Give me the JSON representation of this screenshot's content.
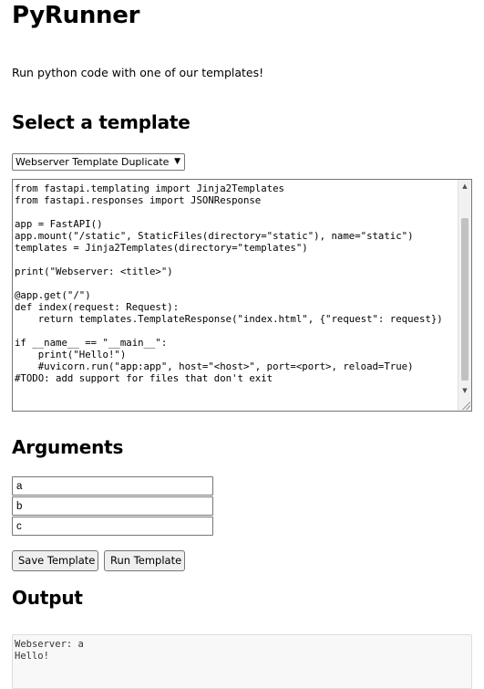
{
  "header": {
    "title": "PyRunner",
    "intro": "Run python code with one of our templates!"
  },
  "template_section": {
    "heading": "Select a template",
    "selected": "Webserver Template Duplicate",
    "code": "from fastapi.templating import Jinja2Templates\nfrom fastapi.responses import JSONResponse\n\napp = FastAPI()\napp.mount(\"/static\", StaticFiles(directory=\"static\"), name=\"static\")\ntemplates = Jinja2Templates(directory=\"templates\")\n\nprint(\"Webserver: <title>\")\n\n@app.get(\"/\")\ndef index(request: Request):\n    return templates.TemplateResponse(\"index.html\", {\"request\": request})\n\nif __name__ == \"__main__\":\n    print(\"Hello!\")\n    #uvicorn.run(\"app:app\", host=\"<host>\", port=<port>, reload=True)\n#TODO: add support for files that don't exit"
  },
  "arguments_section": {
    "heading": "Arguments",
    "args": [
      "a",
      "b",
      "c"
    ]
  },
  "actions": {
    "save_label": "Save Template",
    "run_label": "Run Template"
  },
  "output_section": {
    "heading": "Output",
    "text": "Webserver: a\nHello!"
  },
  "icons": {
    "select_arrow": "chevron-down-icon",
    "scroll_up": "arrow-up-icon",
    "scroll_down": "arrow-down-icon"
  }
}
